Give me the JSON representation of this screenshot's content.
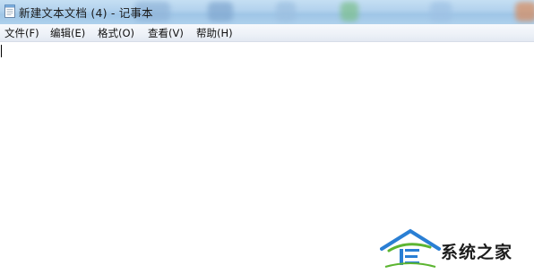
{
  "window": {
    "title": "新建文本文档 (4) - 记事本",
    "icon": "notepad-icon"
  },
  "menubar": {
    "items": [
      {
        "label": "文件(F)"
      },
      {
        "label": "编辑(E)"
      },
      {
        "label": "格式(O)"
      },
      {
        "label": "查看(V)"
      },
      {
        "label": "帮助(H)"
      }
    ]
  },
  "editor": {
    "content": ""
  },
  "watermark": {
    "text": "系统之家",
    "icon": "house-logo-icon"
  },
  "colors": {
    "titlebar": "#b4d3ee",
    "menubar": "#eef2f8",
    "watermark_blue": "#2a7fd4",
    "watermark_green": "#5cb531"
  }
}
